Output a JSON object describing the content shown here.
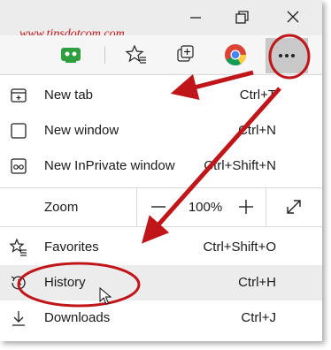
{
  "watermark": "www.tipsdotcom.com",
  "window": {
    "minimize_glyph": "—",
    "maximize_icon": "restore-icon",
    "close_icon": "close-icon"
  },
  "toolbar": {
    "icons": [
      "app-icon",
      "favorites-star-icon",
      "collections-icon",
      "chrome-icon",
      "more-icon"
    ]
  },
  "menu": {
    "items": [
      {
        "label": "New tab",
        "shortcut": "Ctrl+T",
        "icon": "new-tab-icon"
      },
      {
        "label": "New window",
        "shortcut": "Ctrl+N",
        "icon": "new-window-icon"
      },
      {
        "label": "New InPrivate window",
        "shortcut": "Ctrl+Shift+N",
        "icon": "inprivate-icon"
      }
    ],
    "zoom": {
      "label": "Zoom",
      "value": "100%",
      "minus": "−",
      "plus": "+"
    },
    "items2": [
      {
        "label": "Favorites",
        "shortcut": "Ctrl+Shift+O",
        "icon": "favorites-icon"
      },
      {
        "label": "History",
        "shortcut": "Ctrl+H",
        "icon": "history-icon"
      },
      {
        "label": "Downloads",
        "shortcut": "Ctrl+J",
        "icon": "downloads-icon"
      }
    ]
  },
  "colors": {
    "annotation_red": "#c0161a",
    "toolbar_bg": "#f6f6f6",
    "titlebar_bg": "#ececec",
    "hover_bg": "#ececec",
    "more_button_bg": "#c9c9c9"
  }
}
